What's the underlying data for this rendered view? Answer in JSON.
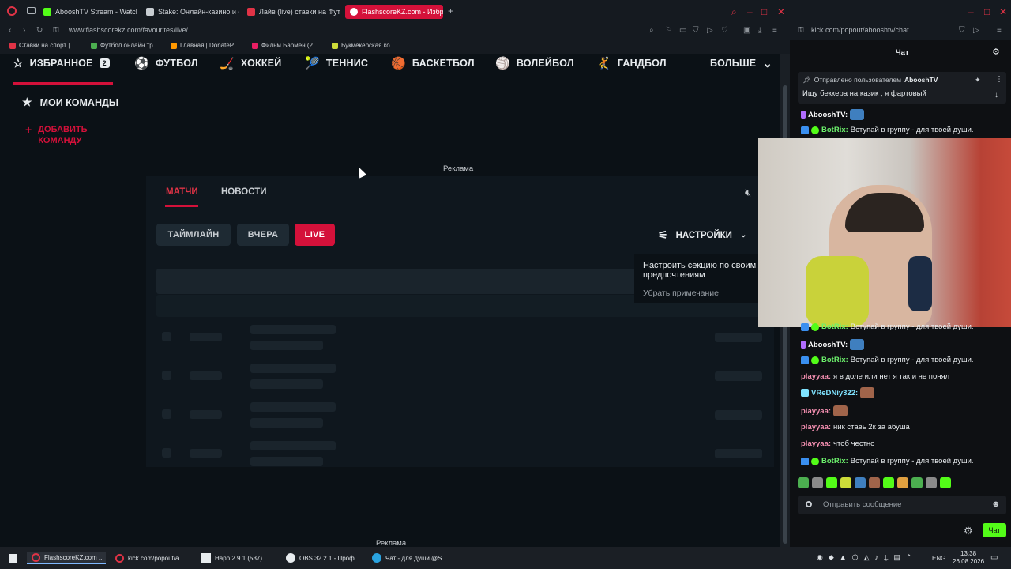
{
  "browser": {
    "tabs": [
      {
        "label": "AbooshTV Stream - Watch",
        "color": "#53fc18"
      },
      {
        "label": "Stake: Онлайн-казино и с",
        "color": "#c8cdd2"
      },
      {
        "label": "Лайв (live) ставки на Футб",
        "color": "#e03346"
      },
      {
        "label": "FlashscoreKZ.com - Избра",
        "color": "#ffffff",
        "active": true
      }
    ],
    "new_tab": "+",
    "url": "www.flashscorekz.com/favourites/live/",
    "chat_url": "kick.com/popout/abooshtv/chat",
    "bookmarks": [
      {
        "label": "Ставки на спорт |...",
        "color": "#e03346"
      },
      {
        "label": "Футбол онлайн тр...",
        "color": "#4caf50"
      },
      {
        "label": "Главная | DonateP...",
        "color": "#ff9800"
      },
      {
        "label": "Фильм Бармен (2...",
        "color": "#e91e63"
      },
      {
        "label": "Букмекерская ко...",
        "color": "#cddc39"
      }
    ]
  },
  "site": {
    "nav": [
      {
        "label": "ИЗБРАННОЕ",
        "icon": "☆",
        "badge": "2"
      },
      {
        "label": "ФУТБОЛ",
        "icon": "⚽"
      },
      {
        "label": "ХОККЕЙ",
        "icon": "🏒"
      },
      {
        "label": "ТЕННИС",
        "icon": "🎾"
      },
      {
        "label": "БАСКЕТБОЛ",
        "icon": "🏀"
      },
      {
        "label": "ВОЛЕЙБОЛ",
        "icon": "🏐"
      },
      {
        "label": "ГАНДБОЛ",
        "icon": "🤾"
      },
      {
        "label": "БОЛЬШЕ",
        "icon": "⌄"
      }
    ],
    "my_teams": "МОИ КОМАНДЫ",
    "add_team": "ДОБАВИТЬ КОМАНДУ",
    "ad_label": "Реклама",
    "subtabs": [
      "МАТЧИ",
      "НОВОСТИ"
    ],
    "filters": [
      "ТАЙМЛАЙН",
      "ВЧЕРА",
      "LIVE"
    ],
    "settings_label": "НАСТРОЙКИ",
    "tooltip_text": "Настроить секцию по своим предпочтениям",
    "tooltip_dismiss": "Убрать примечание",
    "accent": "#d4113a"
  },
  "chat": {
    "title": "Чат",
    "pinned_by_prefix": "Отправлено пользователем",
    "pinned_by_user": "AbooshTV",
    "pinned_text": "Ищу беккера на казик , я фартовый",
    "messages": [
      {
        "user": "AbooshTV:",
        "text": "",
        "ucls": "u-white",
        "emote": true
      },
      {
        "user": "BotRix:",
        "text": "Вступай в группу - для твоей души.",
        "ucls": "u-green"
      },
      {
        "user": "BotRix:",
        "text": "Вступай в группу - для твоей души.",
        "ucls": "u-green"
      },
      {
        "user": "AbooshTV:",
        "text": "",
        "ucls": "u-white",
        "emote": true
      },
      {
        "user": "BotRix:",
        "text": "Вступай в группу - для твоей души.",
        "ucls": "u-green"
      },
      {
        "user": "playyaa:",
        "text": "я в доле или нет я так и не понял",
        "ucls": "u-pink"
      },
      {
        "user": "VReDNiy322:",
        "text": "",
        "ucls": "u-cyan",
        "emote": true
      },
      {
        "user": "playyaa:",
        "text": "",
        "ucls": "u-pink",
        "emote": true
      },
      {
        "user": "playyaa:",
        "text": "ник ставь 2к за абуша",
        "ucls": "u-pink"
      },
      {
        "user": "playyaa:",
        "text": "чтоб честно",
        "ucls": "u-pink"
      },
      {
        "user": "BotRix:",
        "text": "Вступай в группу - для твоей души.",
        "ucls": "u-green"
      }
    ],
    "input_placeholder": "Отправить сообщение",
    "send_label": "Чат"
  },
  "taskbar": {
    "items": [
      {
        "label": "FlashscoreKZ.com ..."
      },
      {
        "label": "kick.com/popout/a..."
      },
      {
        "label": "Happ 2.9.1 (537)"
      },
      {
        "label": "OBS 32.2.1 - Проф..."
      },
      {
        "label": "Чат - для души @S..."
      }
    ],
    "lang": "ENG",
    "time": "13:38",
    "date": "26.08.2026"
  }
}
